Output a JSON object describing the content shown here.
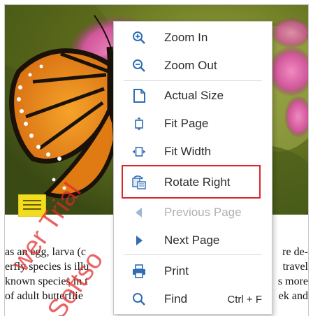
{
  "document": {
    "body_lines": [
      {
        "left": "as an egg, larva (c",
        "right": "re de-"
      },
      {
        "left": "erfly species is illu",
        "right": "travel"
      },
      {
        "left": "known species in t",
        "right": "s more"
      },
      {
        "left": "of adult butterflie",
        "right": "ek and"
      }
    ],
    "watermark_1": "wer Trial",
    "watermark_2": "Softso"
  },
  "context_menu": {
    "items": [
      {
        "label": "Zoom In",
        "icon": "zoom-in-icon",
        "enabled": true
      },
      {
        "label": "Zoom Out",
        "icon": "zoom-out-icon",
        "enabled": true
      },
      {
        "label": "Actual Size",
        "icon": "actual-size-icon",
        "enabled": true
      },
      {
        "label": "Fit Page",
        "icon": "fit-page-icon",
        "enabled": true
      },
      {
        "label": "Fit Width",
        "icon": "fit-width-icon",
        "enabled": true
      },
      {
        "label": "Rotate Right",
        "icon": "rotate-right-icon",
        "enabled": true,
        "highlighted": true
      },
      {
        "label": "Previous Page",
        "icon": "previous-page-icon",
        "enabled": false
      },
      {
        "label": "Next Page",
        "icon": "next-page-icon",
        "enabled": true
      },
      {
        "label": "Print",
        "icon": "print-icon",
        "enabled": true
      },
      {
        "label": "Find",
        "icon": "find-icon",
        "enabled": true,
        "shortcut": "Ctrl + F"
      }
    ]
  },
  "colors": {
    "icon_blue": "#2f6db5",
    "highlight_border": "#d9262d",
    "disabled_text": "#b0b0b0",
    "watermark": "#e22828",
    "note_yellow": "#f2dc1e"
  }
}
